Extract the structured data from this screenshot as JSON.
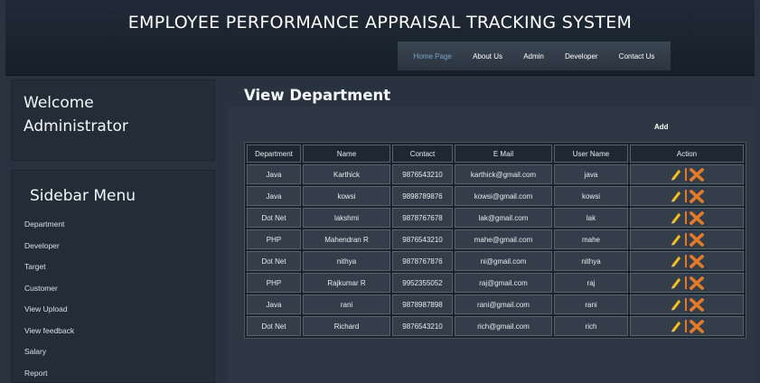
{
  "site_title": "EMPLOYEE PERFORMANCE APPRAISAL TRACKING SYSTEM",
  "nav": [
    {
      "label": "Home Page",
      "active": true
    },
    {
      "label": "About Us"
    },
    {
      "label": "Admin"
    },
    {
      "label": "Developer"
    },
    {
      "label": "Contact Us"
    }
  ],
  "welcome": {
    "line1": "Welcome",
    "line2": "Administrator"
  },
  "sidebar": {
    "title": "Sidebar Menu",
    "items": [
      {
        "label": "Department"
      },
      {
        "label": "Developer"
      },
      {
        "label": "Target"
      },
      {
        "label": "Customer"
      },
      {
        "label": "View Upload"
      },
      {
        "label": "View feedback"
      },
      {
        "label": "Salary"
      },
      {
        "label": "Report"
      }
    ]
  },
  "main": {
    "title": "View Department",
    "add_label": "Add",
    "columns": [
      "Department",
      "Name",
      "Contact",
      "E Mail",
      "User Name",
      "Action"
    ],
    "rows": [
      [
        "Java",
        "Karthick",
        "9876543210",
        "karthick@gmail.com",
        "java"
      ],
      [
        "Java",
        "kowsi",
        "9898789876",
        "kowsi@gmail.com",
        "kowsi"
      ],
      [
        "Dot Net",
        "lakshmi",
        "9878767678",
        "lak@gmail.com",
        "lak"
      ],
      [
        "PHP",
        "Mahendran R",
        "9876543210",
        "mahe@gmail.com",
        "mahe"
      ],
      [
        "Dot Net",
        "nithya",
        "9878767876",
        "ni@gmail.com",
        "nithya"
      ],
      [
        "PHP",
        "Rajkumar R",
        "9952355052",
        "raj@gmail.com",
        "raj"
      ],
      [
        "Java",
        "rani",
        "9878987898",
        "rani@gmail.com",
        "rani"
      ],
      [
        "Dot Net",
        "Richard",
        "9876543210",
        "rich@gmail.com",
        "rich"
      ]
    ]
  },
  "colors": {
    "accent": "#e07b2a",
    "edit_icon": "#f2c230",
    "background": "#2a3440"
  }
}
